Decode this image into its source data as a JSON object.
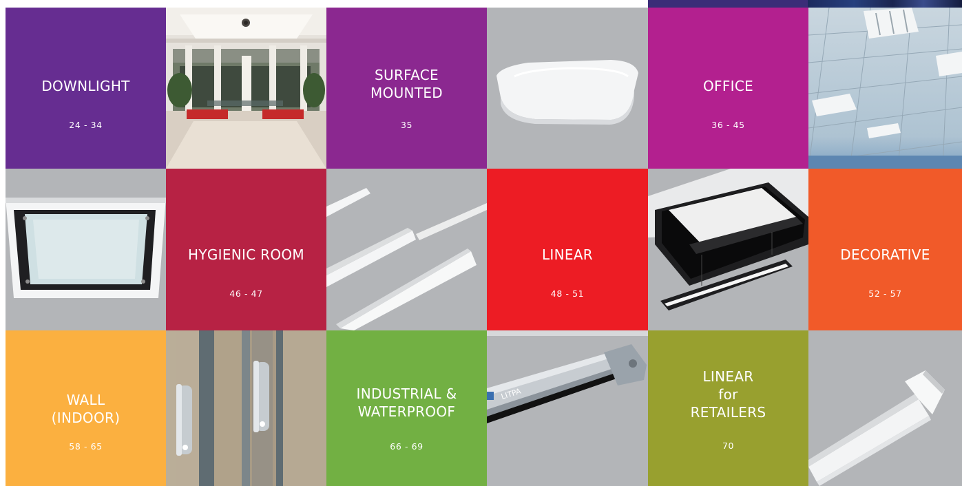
{
  "colors": {
    "downlight": "#662d91",
    "surface_mounted": "#8b2890",
    "office": "#b3208f",
    "hygienic_room": "#b72244",
    "linear": "#ed1c24",
    "decorative": "#f15a29",
    "wall_indoor": "#fbb040",
    "industrial_waterproof": "#72b043",
    "linear_for_retailers": "#98a02f",
    "product_background": "#b3b5b8"
  },
  "categories": [
    {
      "id": "downlight",
      "title": "DOWNLIGHT",
      "pages": "24 - 34"
    },
    {
      "id": "surface_mounted",
      "title": "SURFACE\nMOUNTED",
      "pages": "35"
    },
    {
      "id": "office",
      "title": "OFFICE",
      "pages": "36 - 45"
    },
    {
      "id": "hygienic_room",
      "title": "HYGIENIC ROOM",
      "pages": "46 - 47"
    },
    {
      "id": "linear",
      "title": "LINEAR",
      "pages": "48 - 51"
    },
    {
      "id": "decorative",
      "title": "DECORATIVE",
      "pages": "52 - 57"
    },
    {
      "id": "wall_indoor",
      "title": "WALL\n(INDOOR)",
      "pages": "58 - 65"
    },
    {
      "id": "industrial_waterproof",
      "title": "INDUSTRIAL &\nWATERPROOF",
      "pages": "66 - 69"
    },
    {
      "id": "linear_for_retailers",
      "title": "LINEAR\nfor\nRETAILERS",
      "pages": "70"
    }
  ],
  "product_images": {
    "mall_lobby": "mall-lobby-photo",
    "square_ceiling_light": "square-ceiling-light-photo",
    "office_ceiling": "office-ceiling-troffers-photo",
    "recessed_panel": "recessed-square-panel-photo",
    "linear_recessed": "linear-recessed-profiles-photo",
    "suspended_linear": "suspended-linear-luminaires-photo",
    "wall_up_down": "wall-up-down-lights-photo",
    "waterproof_batten": "waterproof-batten-luminaire-photo",
    "retail_linear": "retail-linear-luminaire-photo",
    "waterproof_brand_text": "LITPA"
  }
}
